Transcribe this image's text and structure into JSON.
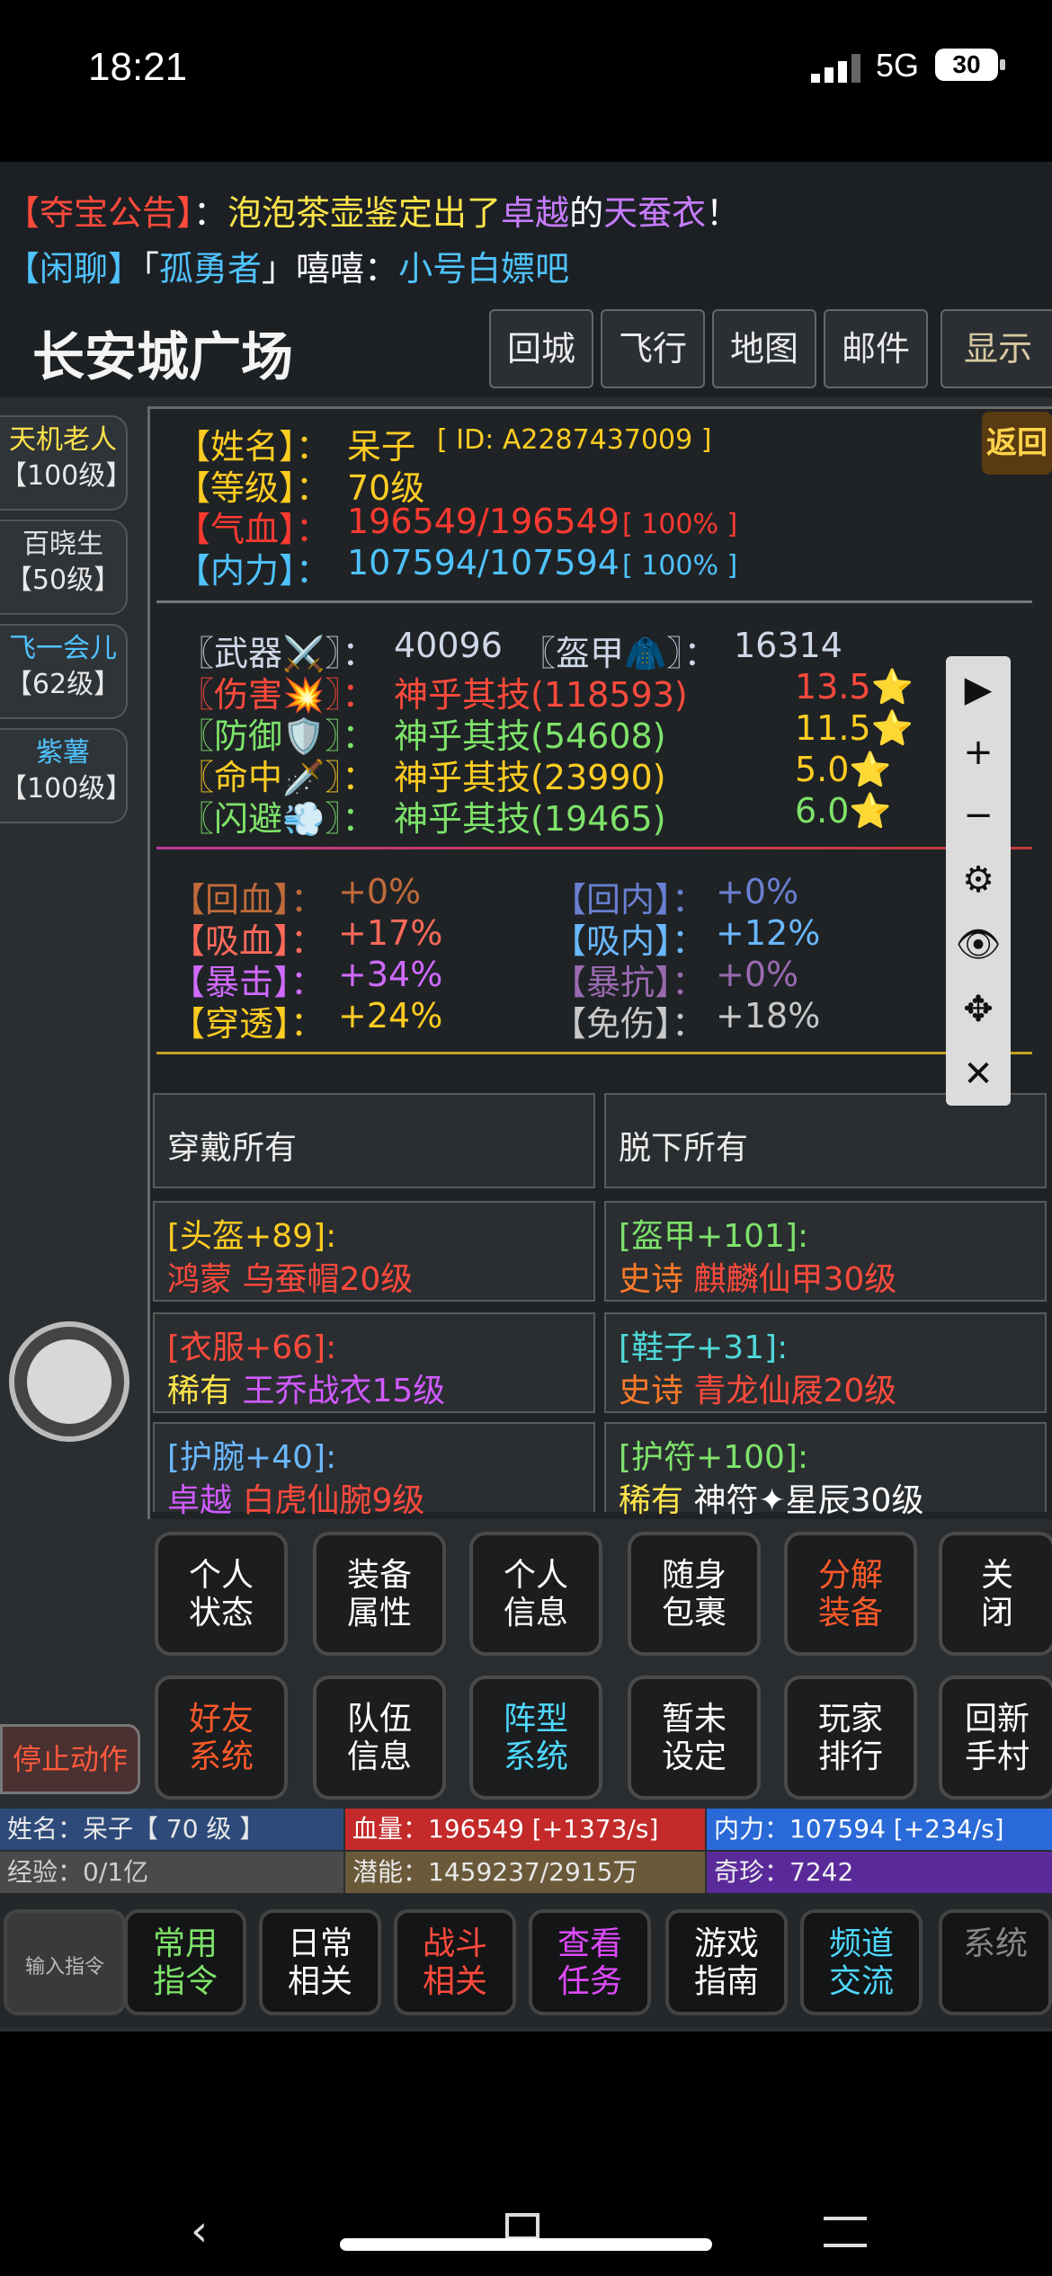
{
  "status": {
    "time": "18:21",
    "network": "5G",
    "battery": "30"
  },
  "chat": [
    {
      "parts": [
        [
          "【夺宝公告】",
          "#ff4a3c"
        ],
        [
          "：",
          "#fff"
        ],
        [
          "泡泡茶壶鉴定出了",
          "#ffe44a"
        ],
        [
          "卓越",
          "#c77cff"
        ],
        [
          "的",
          "#fff"
        ],
        [
          "天蚕衣",
          "#c77cff"
        ],
        [
          "！",
          "#fff"
        ]
      ]
    },
    {
      "parts": [
        [
          "【闲聊】",
          "#4fc3ff"
        ],
        [
          "「",
          "#fff"
        ],
        [
          "孤勇者",
          "#4fc3ff"
        ],
        [
          "」嘻嘻",
          "#fff"
        ],
        [
          "：",
          "#fff"
        ],
        [
          "小号白嫖吧",
          "#4fc3ff"
        ]
      ]
    }
  ],
  "header": {
    "location": "长安城广场",
    "buttons": [
      "回城",
      "飞行",
      "地图",
      "邮件",
      "显示"
    ]
  },
  "npcs": [
    {
      "name": "天机老人",
      "level": "【100级】",
      "color": "#ffe14a"
    },
    {
      "name": "百晓生",
      "level": "【50级】",
      "color": "#e0e0e0"
    },
    {
      "name": "飞一会儿",
      "level": "【62级】",
      "color": "#4fc3ff"
    },
    {
      "name": "紫薯",
      "level": "【100级】",
      "color": "#4fc3ff"
    }
  ],
  "stop_action": "停止动作",
  "return_badge": "返回",
  "profile": {
    "name_label": "【姓名】：",
    "name": "呆子",
    "id": "[ ID: A2287437009 ]",
    "level_label": "【等级】：",
    "level": "70级",
    "hp_label": "【气血】：",
    "hp": "196549/196549",
    "hp_pct": "[ 100% ]",
    "mp_label": "【内力】：",
    "mp": "107594/107594",
    "mp_pct": "[ 100% ]"
  },
  "equip_power": {
    "weapon_label": "〖武器⚔️〗：",
    "weapon": "40096",
    "armor_label": "〖盔甲🧥〗：",
    "armor": "16314"
  },
  "skills": [
    {
      "label": "〖伤害💥〗：",
      "value": "神乎其技(118593)",
      "stars": "13.5⭐",
      "color": "#ff4a3c"
    },
    {
      "label": "〖防御🛡️〗：",
      "value": "神乎其技(54608)",
      "stars": "11.5⭐",
      "color": "#7ee36a"
    },
    {
      "label": "〖命中🗡️〗：",
      "value": "神乎其技(23990)",
      "stars": "5.0⭐",
      "color": "#ffcc22"
    },
    {
      "label": "〖闪避💨〗：",
      "value": "神乎其技(19465)",
      "stars": "6.0⭐",
      "color": "#7ee36a"
    }
  ],
  "attrs": [
    {
      "label": "【回血】：",
      "value": "+0%",
      "color": "#c06a3a"
    },
    {
      "label": "【回内】：",
      "value": "+0%",
      "color": "#6a7fd0"
    },
    {
      "label": "【吸血】：",
      "value": "+17%",
      "color": "#ff6a5a"
    },
    {
      "label": "【吸内】：",
      "value": "+12%",
      "color": "#6ab8ff"
    },
    {
      "label": "【暴击】：",
      "value": "+34%",
      "color": "#d06aff"
    },
    {
      "label": "【暴抗】：",
      "value": "+0%",
      "color": "#9a6ab0"
    },
    {
      "label": "【穿透】：",
      "value": "+24%",
      "color": "#ffcc22"
    },
    {
      "label": "【免伤】：",
      "value": "+18%",
      "color": "#c8c8c8"
    }
  ],
  "gear_actions": {
    "wear_all": "穿戴所有",
    "remove_all": "脱下所有"
  },
  "gear": [
    {
      "slot": "[头盔+89]:",
      "slot_color": "#ffcc22",
      "rarity": "鸿蒙",
      "rarity_color": "#ff4a3c",
      "item": "乌蚕帽20级",
      "item_color": "#ff4a3c"
    },
    {
      "slot": "[盔甲+101]:",
      "slot_color": "#7ee36a",
      "rarity": "史诗",
      "rarity_color": "#ff7a2a",
      "item": "麒麟仙甲30级",
      "item_color": "#ff4a3c"
    },
    {
      "slot": "[衣服+66]:",
      "slot_color": "#ff4a3c",
      "rarity": "稀有",
      "rarity_color": "#ffe44a",
      "item": "王乔战衣15级",
      "item_color": "#d05aff"
    },
    {
      "slot": "[鞋子+31]:",
      "slot_color": "#4fd8d8",
      "rarity": "史诗",
      "rarity_color": "#ff7a2a",
      "item": "青龙仙屐20级",
      "item_color": "#ff4a3c"
    },
    {
      "slot": "[护腕+40]:",
      "slot_color": "#6ab8ff",
      "rarity": "卓越",
      "rarity_color": "#d05aff",
      "item": "白虎仙腕9级",
      "item_color": "#ff4a3c"
    },
    {
      "slot": "[护符+100]:",
      "slot_color": "#7ee36a",
      "rarity": "稀有",
      "rarity_color": "#ffe44a",
      "item": "神符✦星辰30级",
      "item_color": "#ffffff"
    }
  ],
  "toolbar": [
    "▶",
    "+",
    "−",
    "⚙",
    "👁",
    "✥",
    "✕"
  ],
  "menu": [
    {
      "l1": "个人",
      "l2": "状态",
      "color": "#ffffff"
    },
    {
      "l1": "装备",
      "l2": "属性",
      "color": "#ffffff"
    },
    {
      "l1": "个人",
      "l2": "信息",
      "color": "#ffffff"
    },
    {
      "l1": "随身",
      "l2": "包裹",
      "color": "#ffffff"
    },
    {
      "l1": "分解",
      "l2": "装备",
      "color": "#ff5a2a"
    },
    {
      "l1": "关",
      "l2": "闭",
      "color": "#ffffff"
    },
    {
      "l1": "好友",
      "l2": "系统",
      "color": "#ff5a2a"
    },
    {
      "l1": "队伍",
      "l2": "信息",
      "color": "#ffffff"
    },
    {
      "l1": "阵型",
      "l2": "系统",
      "color": "#4fd8ff"
    },
    {
      "l1": "暂未",
      "l2": "设定",
      "color": "#ffffff"
    },
    {
      "l1": "玩家",
      "l2": "排行",
      "color": "#ffffff"
    },
    {
      "l1": "回新",
      "l2": "手村",
      "color": "#ffffff"
    }
  ],
  "bars": {
    "name": "姓名：呆子【 70 级 】",
    "hp": "血量：196549 [+1373/s]",
    "mp": "内力：107594 [+234/s]",
    "exp": "经验：0/1亿",
    "potential": "潜能：1459237/2915万",
    "treasure": "奇珍：7242"
  },
  "commands": [
    {
      "l1": "输入指令",
      "l2": "",
      "color": "#bbbbbb"
    },
    {
      "l1": "常用",
      "l2": "指令",
      "color": "#7ee36a"
    },
    {
      "l1": "日常",
      "l2": "相关",
      "color": "#ffffff"
    },
    {
      "l1": "战斗",
      "l2": "相关",
      "color": "#ff4a3c"
    },
    {
      "l1": "查看",
      "l2": "任务",
      "color": "#e04aff"
    },
    {
      "l1": "游戏",
      "l2": "指南",
      "color": "#ffffff"
    },
    {
      "l1": "频道",
      "l2": "交流",
      "color": "#4fd8ff"
    },
    {
      "l1": "系统",
      "l2": "",
      "color": "#888888"
    }
  ]
}
